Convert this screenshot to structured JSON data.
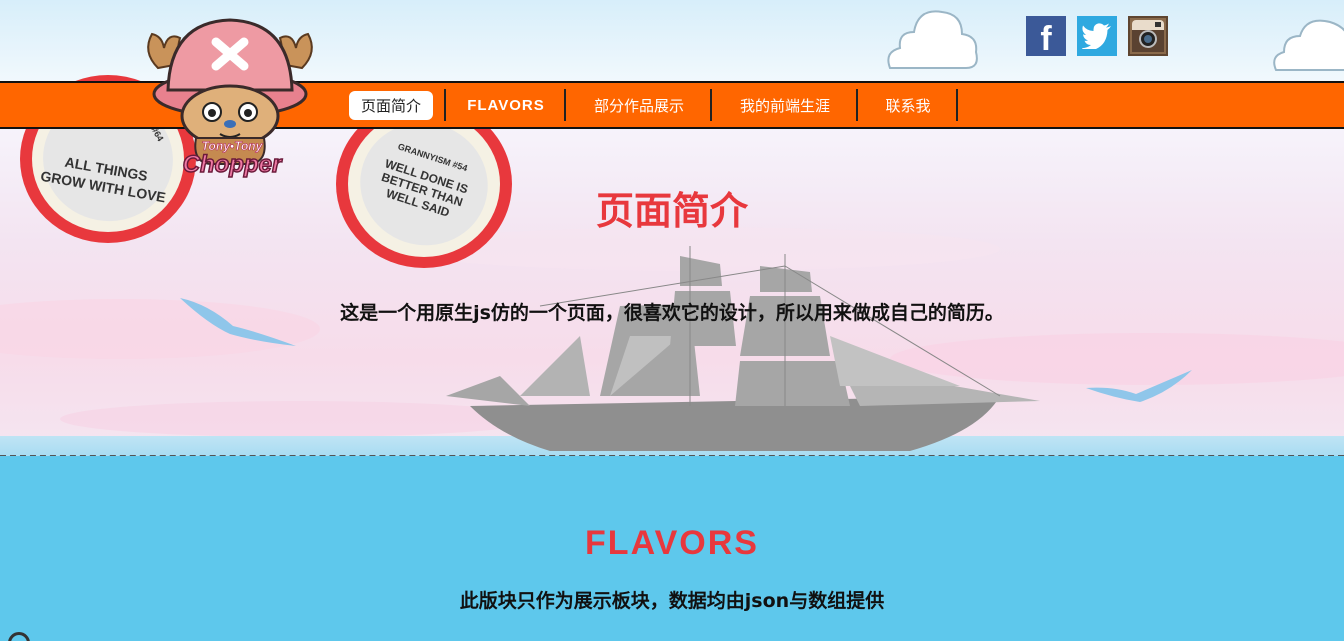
{
  "social": {
    "facebook_glyph": "f",
    "icons": [
      "facebook-icon",
      "twitter-icon",
      "instagram-icon"
    ]
  },
  "nav": {
    "items": [
      {
        "label": "页面简介",
        "active": true
      },
      {
        "label": "FLAVORS",
        "active": false
      },
      {
        "label": "部分作品展示",
        "active": false
      },
      {
        "label": "我的前端生涯",
        "active": false
      },
      {
        "label": "联系我",
        "active": false
      }
    ]
  },
  "logo": {
    "text_line1": "Tony•Tony",
    "text_line2": "Chopper"
  },
  "badges": [
    {
      "text": "ALL THINGS GROW WITH LOVE",
      "number": "#64"
    },
    {
      "text": "WELL DONE IS BETTER THAN WELL SAID",
      "header": "GRANNYISM #54"
    }
  ],
  "intro": {
    "title": "页面简介",
    "description": "这是一个用原生js仿的一个页面，很喜欢它的设计，所以用来做成自己的简历。"
  },
  "flavors": {
    "title": "FLAVORS",
    "description": "此版块只作为展示板块，数据均由json与数组提供"
  },
  "colors": {
    "nav_bg": "#ff6600",
    "title_red": "#e8383d",
    "sea_blue": "#5ec8ec"
  }
}
